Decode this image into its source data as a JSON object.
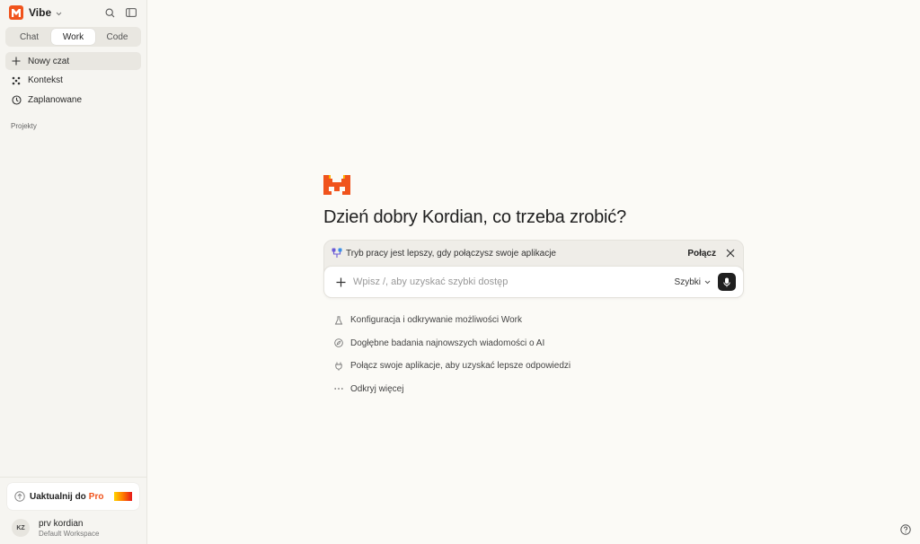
{
  "app": {
    "name": "Vibe",
    "brand_color": "#f0531c"
  },
  "sidebar": {
    "modes": [
      {
        "label": "Chat",
        "active": false
      },
      {
        "label": "Work",
        "active": true
      },
      {
        "label": "Code",
        "active": false
      }
    ],
    "nav": [
      {
        "label": "Nowy czat",
        "icon": "plus-icon",
        "active": true
      },
      {
        "label": "Kontekst",
        "icon": "context-icon",
        "active": false
      },
      {
        "label": "Zaplanowane",
        "icon": "clock-icon",
        "active": false
      }
    ],
    "section_label": "Projekty",
    "upgrade": {
      "text": "Uaktualnij do",
      "pro": "Pro"
    },
    "user": {
      "initials": "KZ",
      "name": "prv kordian",
      "workspace": "Default Workspace"
    }
  },
  "main": {
    "greeting": "Dzień dobry Kordian, co trzeba zrobić?",
    "banner": {
      "text": "Tryb pracy jest lepszy, gdy połączysz swoje aplikacje",
      "connect_label": "Połącz"
    },
    "composer": {
      "placeholder": "Wpisz /, aby uzyskać szybki dostęp",
      "value": "",
      "model": "Szybki"
    },
    "suggestions": [
      {
        "label": "Konfiguracja i odkrywanie możliwości Work",
        "icon": "flask-icon"
      },
      {
        "label": "Dogłębne badania najnowszych wiadomości o AI",
        "icon": "compass-icon"
      },
      {
        "label": "Połącz swoje aplikacje, aby uzyskać lepsze odpowiedzi",
        "icon": "plug-icon"
      },
      {
        "label": "Odkryj więcej",
        "icon": "ellipsis-icon"
      }
    ]
  }
}
